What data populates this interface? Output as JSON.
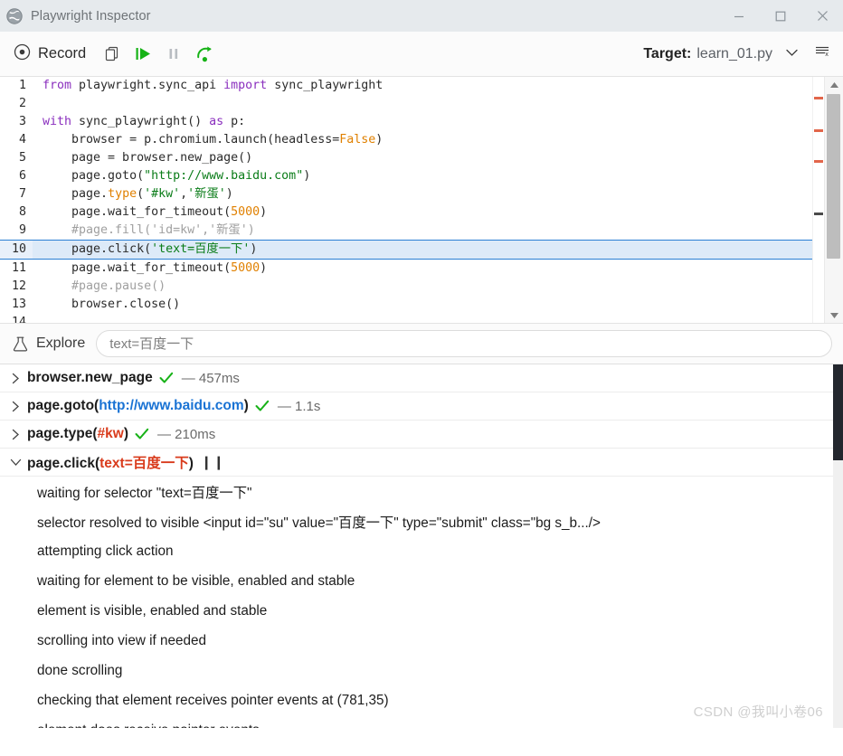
{
  "window": {
    "title": "Playwright Inspector",
    "icon": "playwright-globe-icon",
    "minimize_label": "Minimize",
    "maximize_label": "Maximize",
    "close_label": "Close"
  },
  "toolbar": {
    "record_label": "Record",
    "record_icon": "record-circle-icon",
    "copy_icon": "copy-icon",
    "resume_icon": "resume-play-icon",
    "pause_icon": "pause-icon",
    "step_over_icon": "step-over-icon",
    "target_label": "Target:",
    "target_value": "learn_01.py",
    "target_chevron_icon": "chevron-down-icon",
    "clear_icon": "clear-list-icon"
  },
  "editor": {
    "language": "python",
    "active_line": 10,
    "lines": [
      {
        "num": "1",
        "tokens": [
          {
            "t": "from ",
            "c": "kw"
          },
          {
            "t": "playwright.sync_api ",
            "c": "plain"
          },
          {
            "t": "import ",
            "c": "kw"
          },
          {
            "t": "sync_playwright",
            "c": "plain"
          }
        ]
      },
      {
        "num": "2",
        "tokens": [
          {
            "t": "",
            "c": "plain"
          }
        ]
      },
      {
        "num": "3",
        "tokens": [
          {
            "t": "with ",
            "c": "kw"
          },
          {
            "t": "sync_playwright() ",
            "c": "plain"
          },
          {
            "t": "as ",
            "c": "kw"
          },
          {
            "t": "p:",
            "c": "plain"
          }
        ]
      },
      {
        "num": "4",
        "tokens": [
          {
            "t": "    browser = p.chromium.launch(headless=",
            "c": "plain"
          },
          {
            "t": "False",
            "c": "const"
          },
          {
            "t": ")",
            "c": "plain"
          }
        ]
      },
      {
        "num": "5",
        "tokens": [
          {
            "t": "    page = browser.new_page()",
            "c": "plain"
          }
        ]
      },
      {
        "num": "6",
        "tokens": [
          {
            "t": "    page.goto(",
            "c": "plain"
          },
          {
            "t": "\"http://www.baidu.com\"",
            "c": "str"
          },
          {
            "t": ")",
            "c": "plain"
          }
        ]
      },
      {
        "num": "7",
        "tokens": [
          {
            "t": "    page.",
            "c": "plain"
          },
          {
            "t": "type",
            "c": "fn"
          },
          {
            "t": "(",
            "c": "plain"
          },
          {
            "t": "'#kw'",
            "c": "str"
          },
          {
            "t": ",",
            "c": "plain"
          },
          {
            "t": "'新蛋'",
            "c": "str"
          },
          {
            "t": ")",
            "c": "plain"
          }
        ]
      },
      {
        "num": "8",
        "tokens": [
          {
            "t": "    page.wait_for_timeout(",
            "c": "plain"
          },
          {
            "t": "5000",
            "c": "num"
          },
          {
            "t": ")",
            "c": "plain"
          }
        ]
      },
      {
        "num": "9",
        "tokens": [
          {
            "t": "    #page.fill('id=kw','新蛋')",
            "c": "com"
          }
        ]
      },
      {
        "num": "10",
        "tokens": [
          {
            "t": "    page.click(",
            "c": "plain"
          },
          {
            "t": "'text=百度一下'",
            "c": "str"
          },
          {
            "t": ")",
            "c": "plain"
          }
        ]
      },
      {
        "num": "11",
        "tokens": [
          {
            "t": "    page.wait_for_timeout(",
            "c": "plain"
          },
          {
            "t": "5000",
            "c": "num"
          },
          {
            "t": ")",
            "c": "plain"
          }
        ]
      },
      {
        "num": "12",
        "tokens": [
          {
            "t": "    #page.pause()",
            "c": "com"
          }
        ]
      },
      {
        "num": "13",
        "tokens": [
          {
            "t": "    browser.close()",
            "c": "plain"
          }
        ]
      },
      {
        "num": "14",
        "tokens": [
          {
            "t": "",
            "c": "plain"
          }
        ]
      }
    ]
  },
  "explore": {
    "icon": "flask-icon",
    "label": "Explore",
    "value": "text=百度一下",
    "placeholder": "text=百度一下"
  },
  "log": {
    "actions": [
      {
        "chevron": "chevron-right-icon",
        "expanded": false,
        "name": "browser.new_page",
        "param": "",
        "param_type": "",
        "status": "ok",
        "duration": "— 457ms",
        "running": false
      },
      {
        "chevron": "chevron-right-icon",
        "expanded": false,
        "name": "page.goto(",
        "param": "http://www.baidu.com",
        "param_type": "url",
        "name_suffix": ")",
        "status": "ok",
        "duration": "— 1.1s",
        "running": false
      },
      {
        "chevron": "chevron-right-icon",
        "expanded": false,
        "name": "page.type(",
        "param": "#kw",
        "param_type": "selector",
        "name_suffix": ")",
        "status": "ok",
        "duration": "— 210ms",
        "running": false
      },
      {
        "chevron": "chevron-down-icon",
        "expanded": true,
        "name": "page.click(",
        "param": "text=百度一下",
        "param_type": "selector",
        "name_suffix": ")",
        "status": "paused",
        "duration": "",
        "running": true,
        "pause_mark": "❙❙"
      }
    ],
    "details": [
      "waiting for selector \"text=百度一下\"",
      "selector resolved to visible <input id=\"su\" value=\"百度一下\" type=\"submit\" class=\"bg s_b.../>",
      "attempting click action",
      "waiting for element to be visible, enabled and stable",
      "element is visible, enabled and stable",
      "scrolling into view if needed",
      "done scrolling",
      "checking that element receives pointer events at (781,35)",
      "element does receive pointer events"
    ]
  },
  "watermark": "CSDN @我叫小卷06",
  "colors": {
    "accent_green": "#18b218",
    "selector_red": "#d93b1c",
    "url_blue": "#1a73d4",
    "active_line_bg": "#ddeaf8",
    "active_line_border": "#2a7fd4",
    "titlebar_bg": "#e6eaed"
  }
}
